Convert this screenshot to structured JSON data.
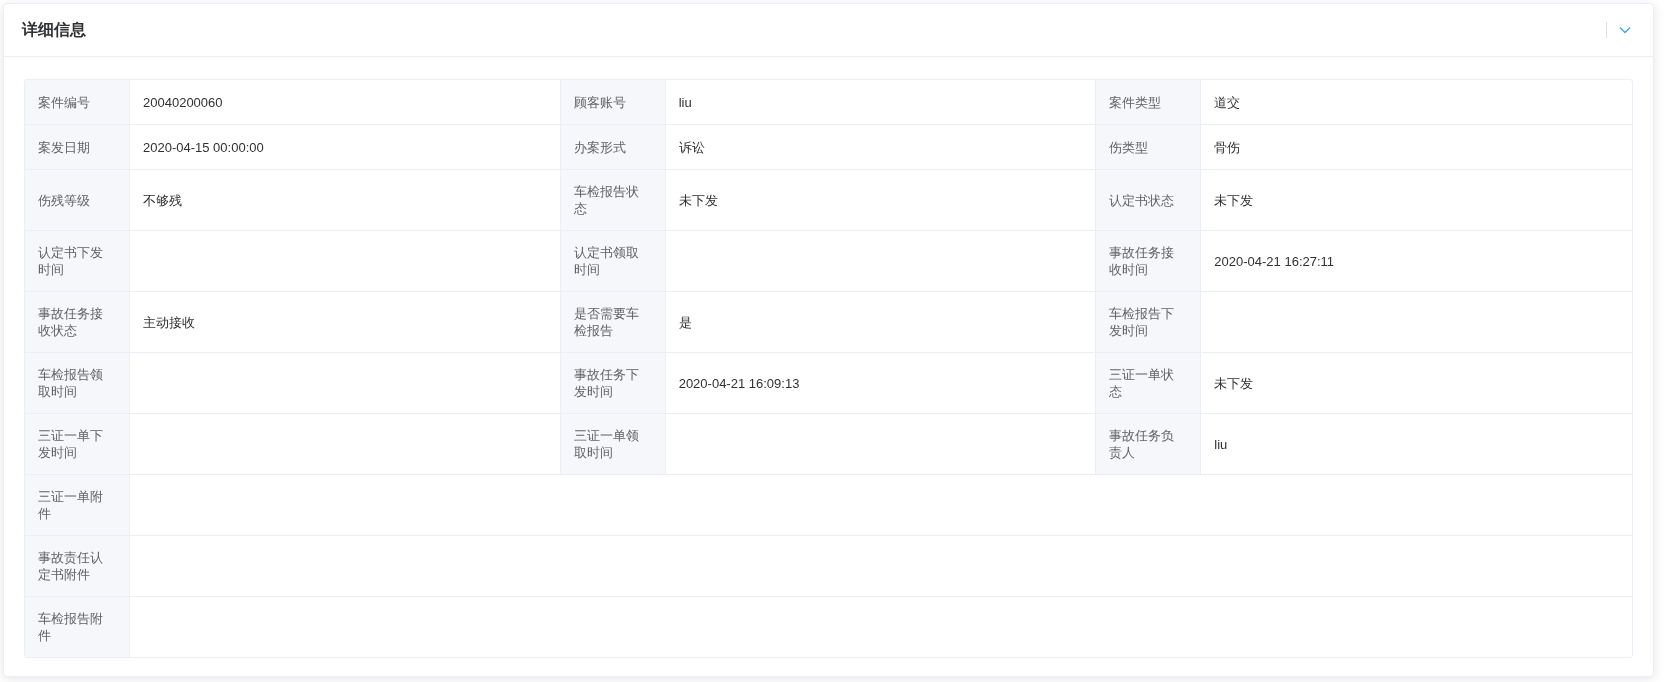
{
  "panel": {
    "title": "详细信息",
    "collapse_toggle": {
      "expanded": true
    }
  },
  "rows": [
    [
      {
        "label": "案件编号",
        "value": "20040200060"
      },
      {
        "label": "顾客账号",
        "value": "liu"
      },
      {
        "label": "案件类型",
        "value": "道交"
      }
    ],
    [
      {
        "label": "案发日期",
        "value": "2020-04-15 00:00:00"
      },
      {
        "label": "办案形式",
        "value": "诉讼"
      },
      {
        "label": "伤类型",
        "value": "骨伤"
      }
    ],
    [
      {
        "label": "伤残等级",
        "value": "不够残"
      },
      {
        "label": "车检报告状态",
        "value": "未下发"
      },
      {
        "label": "认定书状态",
        "value": "未下发"
      }
    ],
    [
      {
        "label": "认定书下发时间"
      },
      {
        "label": "认定书领取时间"
      },
      {
        "label": "事故任务接收时间",
        "value": "2020-04-21 16:27:11"
      }
    ],
    [
      {
        "label": "事故任务接收状态",
        "value": "主动接收"
      },
      {
        "label": "是否需要车检报告",
        "value": "是"
      },
      {
        "label": "车检报告下发时间"
      }
    ],
    [
      {
        "label": "车检报告领取时间"
      },
      {
        "label": "事故任务下发时间",
        "value": "2020-04-21 16:09:13"
      },
      {
        "label": "三证一单状态",
        "value": "未下发"
      }
    ],
    [
      {
        "label": "三证一单下发时间"
      },
      {
        "label": "三证一单领取时间"
      },
      {
        "label": "事故任务负责人",
        "value": "liu"
      }
    ],
    [
      {
        "label": "三证一单附件"
      }
    ],
    [
      {
        "label": "事故责任认定书附件"
      }
    ],
    [
      {
        "label": "车检报告附件"
      }
    ]
  ]
}
